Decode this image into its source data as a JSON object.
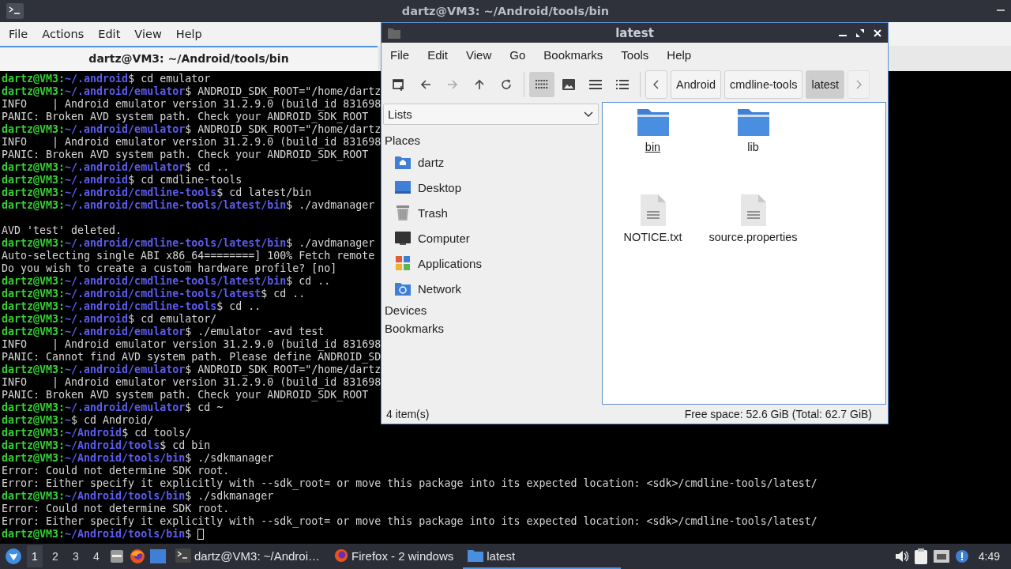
{
  "terminal": {
    "title": "dartz@VM3: ~/Android/tools/bin",
    "menu": [
      "File",
      "Actions",
      "Edit",
      "View",
      "Help"
    ],
    "tab": {
      "title": "dartz@VM3: ~/Android/tools/bin",
      "selected": true
    },
    "lines": [
      {
        "kind": "prompt",
        "user": "dartz@VM3:",
        "path": "~/.android",
        "text": "$ cd emulator"
      },
      {
        "kind": "prompt",
        "user": "dartz@VM3:",
        "path": "~/.android/emulator",
        "text": "$ ANDROID_SDK_ROOT=\"/home/dartz"
      },
      {
        "kind": "output",
        "text": "INFO    | Android emulator version 31.2.9.0 (build_id 831698"
      },
      {
        "kind": "output",
        "text": "PANIC: Broken AVD system path. Check your ANDROID_SDK_ROOT"
      },
      {
        "kind": "prompt",
        "user": "dartz@VM3:",
        "path": "~/.android/emulator",
        "text": "$ ANDROID_SDK_ROOT=\"/home/dartz"
      },
      {
        "kind": "output",
        "text": "INFO    | Android emulator version 31.2.9.0 (build_id 831698"
      },
      {
        "kind": "output",
        "text": "PANIC: Broken AVD system path. Check your ANDROID_SDK_ROOT"
      },
      {
        "kind": "prompt",
        "user": "dartz@VM3:",
        "path": "~/.android/emulator",
        "text": "$ cd .."
      },
      {
        "kind": "prompt",
        "user": "dartz@VM3:",
        "path": "~/.android",
        "text": "$ cd cmdline-tools"
      },
      {
        "kind": "prompt",
        "user": "dartz@VM3:",
        "path": "~/.android/cmdline-tools",
        "text": "$ cd latest/bin"
      },
      {
        "kind": "prompt",
        "user": "dartz@VM3:",
        "path": "~/.android/cmdline-tools/latest/bin",
        "text": "$ ./avdmanager"
      },
      {
        "kind": "blank"
      },
      {
        "kind": "output",
        "text": "AVD 'test' deleted."
      },
      {
        "kind": "prompt",
        "user": "dartz@VM3:",
        "path": "~/.android/cmdline-tools/latest/bin",
        "text": "$ ./avdmanager"
      },
      {
        "kind": "output",
        "text": "Auto-selecting single ABI x86_64========] 100% Fetch remote"
      },
      {
        "kind": "output",
        "text": "Do you wish to create a custom hardware profile? [no]"
      },
      {
        "kind": "prompt",
        "user": "dartz@VM3:",
        "path": "~/.android/cmdline-tools/latest/bin",
        "text": "$ cd .."
      },
      {
        "kind": "prompt",
        "user": "dartz@VM3:",
        "path": "~/.android/cmdline-tools/latest",
        "text": "$ cd .."
      },
      {
        "kind": "prompt",
        "user": "dartz@VM3:",
        "path": "~/.android/cmdline-tools",
        "text": "$ cd .."
      },
      {
        "kind": "prompt",
        "user": "dartz@VM3:",
        "path": "~/.android",
        "text": "$ cd emulator/"
      },
      {
        "kind": "prompt",
        "user": "dartz@VM3:",
        "path": "~/.android/emulator",
        "text": "$ ./emulator -avd test"
      },
      {
        "kind": "output",
        "text": "INFO    | Android emulator version 31.2.9.0 (build_id 831698"
      },
      {
        "kind": "output",
        "text": "PANIC: Cannot find AVD system path. Please define ANDROID_SD"
      },
      {
        "kind": "prompt",
        "user": "dartz@VM3:",
        "path": "~/.android/emulator",
        "text": "$ ANDROID_SDK_ROOT=\"/home/dartz"
      },
      {
        "kind": "output",
        "text": "INFO    | Android emulator version 31.2.9.0 (build_id 831698"
      },
      {
        "kind": "output",
        "text": "PANIC: Broken AVD system path. Check your ANDROID_SDK_ROOT"
      },
      {
        "kind": "prompt",
        "user": "dartz@VM3:",
        "path": "~/.android/emulator",
        "text": "$ cd ~"
      },
      {
        "kind": "prompt",
        "user": "dartz@VM3:",
        "path": "~",
        "text": "$ cd Android/"
      },
      {
        "kind": "prompt",
        "user": "dartz@VM3:",
        "path": "~/Android",
        "text": "$ cd tools/"
      },
      {
        "kind": "prompt",
        "user": "dartz@VM3:",
        "path": "~/Android/tools",
        "text": "$ cd bin"
      },
      {
        "kind": "prompt",
        "user": "dartz@VM3:",
        "path": "~/Android/tools/bin",
        "text": "$ ./sdkmanager"
      },
      {
        "kind": "output",
        "text": "Error: Could not determine SDK root."
      },
      {
        "kind": "output",
        "text": "Error: Either specify it explicitly with --sdk_root= or move this package into its expected location: <sdk>/cmdline-tools/latest/"
      },
      {
        "kind": "prompt",
        "user": "dartz@VM3:",
        "path": "~/Android/tools/bin",
        "text": "$ ./sdkmanager"
      },
      {
        "kind": "output",
        "text": "Error: Could not determine SDK root."
      },
      {
        "kind": "output",
        "text": "Error: Either specify it explicitly with --sdk_root= or move this package into its expected location: <sdk>/cmdline-tools/latest/"
      },
      {
        "kind": "prompt",
        "user": "dartz@VM3:",
        "path": "~/Android/tools/bin",
        "text": "$",
        "cursor": true
      }
    ]
  },
  "file_manager": {
    "title": "latest",
    "menu": [
      "File",
      "Edit",
      "View",
      "Go",
      "Bookmarks",
      "Tools",
      "Help"
    ],
    "nav_buttons": [
      {
        "kind": "new-tab",
        "disabled": false
      },
      {
        "kind": "back",
        "disabled": false
      },
      {
        "kind": "forward",
        "disabled": true
      },
      {
        "kind": "up",
        "disabled": false
      },
      {
        "kind": "reload",
        "disabled": false
      }
    ],
    "view_modes": [
      {
        "kind": "icons",
        "selected": true
      },
      {
        "kind": "thumbnails",
        "selected": false
      },
      {
        "kind": "compact",
        "selected": false
      },
      {
        "kind": "details",
        "selected": false
      }
    ],
    "path_bar": {
      "back_disabled": false,
      "forward_disabled": true,
      "crumbs": [
        {
          "label": "Android",
          "selected": false
        },
        {
          "label": "cmdline-tools",
          "selected": false
        },
        {
          "label": "latest",
          "selected": true
        }
      ]
    },
    "pane_selector": {
      "value": "Lists"
    },
    "sections": [
      {
        "title": "Places",
        "items": [
          {
            "label": "dartz",
            "kind": "home"
          },
          {
            "label": "Desktop",
            "kind": "desktop"
          },
          {
            "label": "Trash",
            "kind": "trash"
          },
          {
            "label": "Computer",
            "kind": "computer"
          },
          {
            "label": "Applications",
            "kind": "applications"
          },
          {
            "label": "Network",
            "kind": "network"
          }
        ]
      },
      {
        "title": "Devices"
      },
      {
        "title": "Bookmarks"
      }
    ],
    "files": [
      {
        "name": "bin",
        "kind": "folder",
        "focused": true
      },
      {
        "name": "lib",
        "kind": "folder",
        "focused": false
      },
      {
        "name": "NOTICE.txt",
        "kind": "document",
        "focused": false
      },
      {
        "name": "source.properties",
        "kind": "document",
        "focused": false
      }
    ],
    "item_count": "4 item(s)",
    "free_space": "Free space: 52.6 GiB (Total: 62.7 GiB)"
  },
  "taskbar": {
    "workspaces": [
      {
        "label": "1",
        "selected": true
      },
      {
        "label": "2",
        "selected": false
      },
      {
        "label": "3",
        "selected": false
      },
      {
        "label": "4",
        "selected": false
      }
    ],
    "launchers": [
      {
        "kind": "file-manager"
      },
      {
        "kind": "firefox"
      },
      {
        "kind": "desktop"
      }
    ],
    "tasks": [
      {
        "label": "dartz@VM3: ~/Androi…",
        "kind": "terminal",
        "selected": false
      },
      {
        "label": "Firefox - 2 windows",
        "kind": "firefox",
        "selected": false
      },
      {
        "label": "latest",
        "kind": "folder",
        "selected": true
      }
    ],
    "tray": [
      {
        "kind": "volume"
      },
      {
        "kind": "clipboard"
      },
      {
        "kind": "network"
      },
      {
        "kind": "notification"
      }
    ],
    "clock": "4:49"
  }
}
